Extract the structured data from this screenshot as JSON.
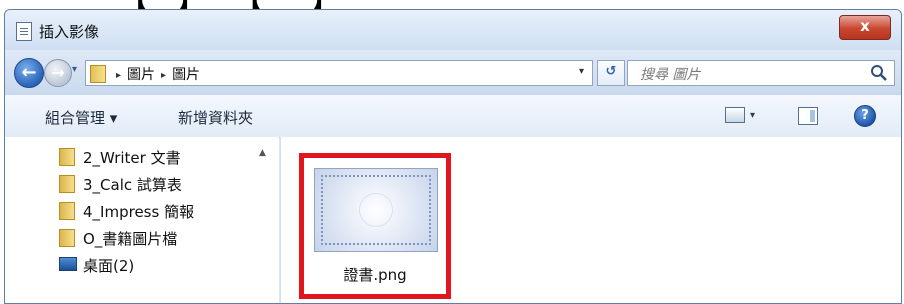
{
  "window": {
    "title": "插入影像",
    "close_label": "x"
  },
  "nav": {
    "back_label": "←",
    "forward_label": "→",
    "recent_label": "▾",
    "breadcrumb": [
      "圖片",
      "圖片"
    ],
    "breadcrumb_separator": "▸",
    "address_dropdown": "▾",
    "refresh_label": "↺",
    "search_placeholder": "搜尋 圖片"
  },
  "toolbar": {
    "organize_label": "組合管理 ▾",
    "new_folder_label": "新增資料夾",
    "view_dropdown": "▾",
    "help_label": "?"
  },
  "sidebar": {
    "items": [
      {
        "label": "2_Writer 文書",
        "icon": "folder-icon"
      },
      {
        "label": "3_Calc 試算表",
        "icon": "folder-icon"
      },
      {
        "label": "4_Impress 簡報",
        "icon": "folder-icon"
      },
      {
        "label": "O_書籍圖片檔",
        "icon": "folder-icon"
      },
      {
        "label": "桌面(2)",
        "icon": "desktop-icon"
      }
    ],
    "scroll_up": "▲"
  },
  "files": [
    {
      "name": "證書.png"
    }
  ],
  "colors": {
    "highlight": "#e0151d",
    "accent": "#2a63b8"
  }
}
